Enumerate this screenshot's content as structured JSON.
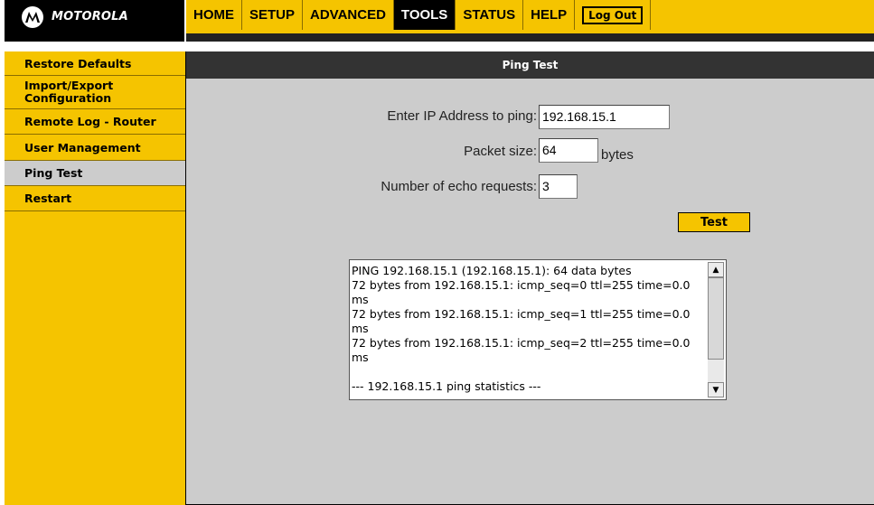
{
  "brand": {
    "name": "MOTOROLA",
    "logo_icon": "motorola-batwing-logo"
  },
  "nav": {
    "tabs": [
      {
        "label": "HOME",
        "active": false
      },
      {
        "label": "SETUP",
        "active": false
      },
      {
        "label": "ADVANCED",
        "active": false
      },
      {
        "label": "TOOLS",
        "active": true
      },
      {
        "label": "STATUS",
        "active": false
      },
      {
        "label": "HELP",
        "active": false
      }
    ],
    "logout_label": "Log Out"
  },
  "sidebar": {
    "items": [
      {
        "label": "Restore Defaults",
        "active": false
      },
      {
        "label": "Import/Export Configuration",
        "active": false
      },
      {
        "label": "Remote Log - Router",
        "active": false
      },
      {
        "label": "User Management",
        "active": false
      },
      {
        "label": "Ping Test",
        "active": true
      },
      {
        "label": "Restart",
        "active": false
      }
    ]
  },
  "main": {
    "title": "Ping Test",
    "ip_label": "Enter IP Address to ping:",
    "ip_value": "192.168.15.1",
    "packet_label": "Packet size:",
    "packet_value": "64",
    "packet_unit": "bytes",
    "echo_label": "Number of echo requests:",
    "echo_value": "3",
    "test_button": "Test",
    "output": "PING 192.168.15.1 (192.168.15.1): 64 data bytes\n72 bytes from 192.168.15.1: icmp_seq=0 ttl=255 time=0.0 ms\n72 bytes from 192.168.15.1: icmp_seq=1 ttl=255 time=0.0 ms\n72 bytes from 192.168.15.1: icmp_seq=2 ttl=255 time=0.0 ms\n\n--- 192.168.15.1 ping statistics ---"
  },
  "colors": {
    "accent": "#f5c400",
    "dark": "#000000",
    "panel": "#cccccc",
    "title_bar": "#333333"
  }
}
